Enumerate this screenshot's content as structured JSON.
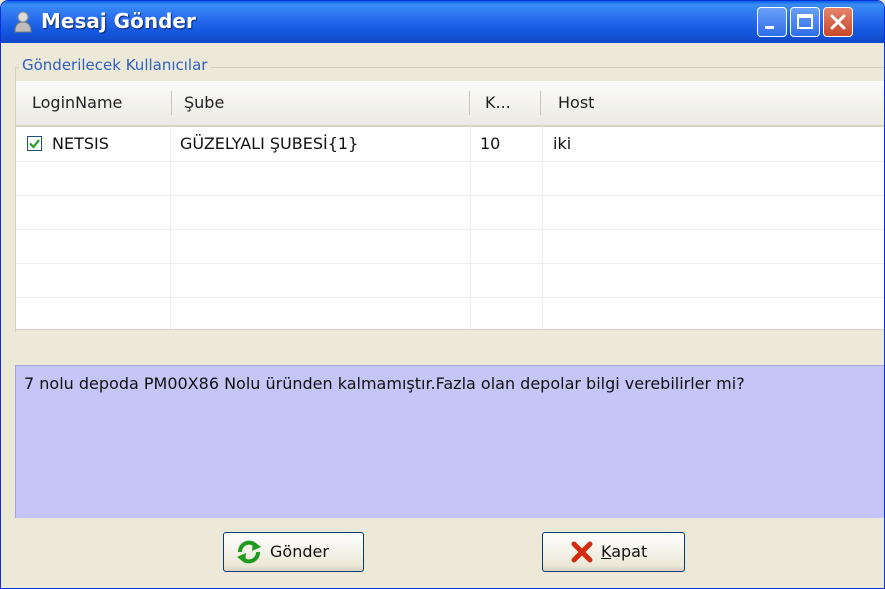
{
  "window": {
    "title": "Mesaj Gönder",
    "icon": "user-icon",
    "controls": [
      "minimize-icon",
      "maximize-icon",
      "close-icon"
    ]
  },
  "group": {
    "caption": "Gönderilecek Kullanıcılar"
  },
  "grid": {
    "columns": [
      "LoginName",
      "Şube",
      "K...",
      "Host"
    ],
    "rows": [
      {
        "checked": true,
        "login": "NETSIS",
        "branch": "GÜZELYALI ŞUBESİ{1}",
        "k": "10",
        "host": "iki"
      }
    ]
  },
  "message": {
    "text": "7 nolu depoda PM00X86 Nolu üründen kalmamıştır.Fazla olan depolar bilgi verebilirler mi?",
    "background": "#c6c5f8"
  },
  "buttons": {
    "send": {
      "label": "Gönder",
      "icon": "refresh-icon"
    },
    "close": {
      "label_accel": "K",
      "label_rest": "apat",
      "icon": "x-icon"
    }
  },
  "colors": {
    "titlebar": "#1559e0",
    "caption": "#3060c0",
    "close_button": "#c9482a"
  }
}
